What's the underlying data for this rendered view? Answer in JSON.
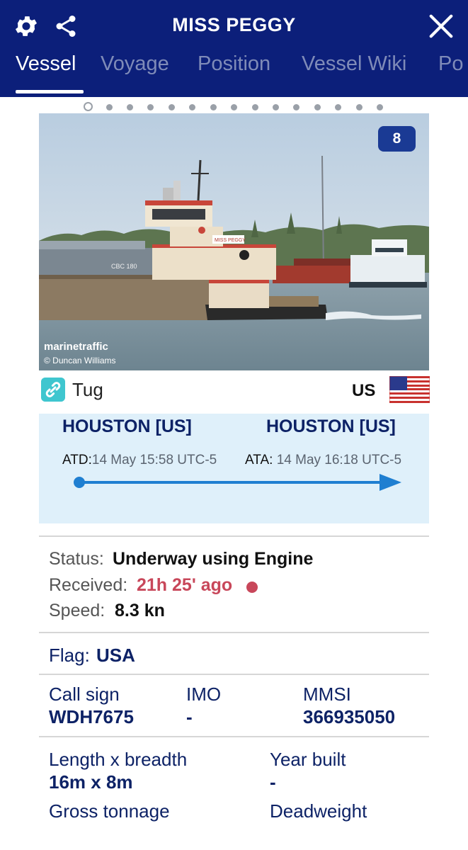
{
  "header": {
    "title": "MISS PEGGY",
    "tabs": [
      {
        "label": "Vessel",
        "active": true
      },
      {
        "label": "Voyage",
        "active": false
      },
      {
        "label": "Position",
        "active": false
      },
      {
        "label": "Vessel Wiki",
        "active": false
      },
      {
        "label": "Po",
        "active": false
      }
    ],
    "icons": [
      "gear-icon",
      "share-icon",
      "close-icon"
    ],
    "bg_color": "#0c1f7a"
  },
  "gallery": {
    "photo_count": "8",
    "watermark": "marinetraffic",
    "credit": "© Duncan Williams",
    "page_indicator": {
      "total": 15,
      "current": 1
    }
  },
  "vessel_type": {
    "type": "Tug",
    "country_code": "US",
    "icon": "link-icon",
    "flag_icon": "us-flag-icon"
  },
  "route": {
    "departure_port": "HOUSTON [US]",
    "arrival_port": "HOUSTON [US]",
    "atd_label": "ATD:",
    "atd_value": "14 May 15:58 UTC-5",
    "ata_label": "ATA:",
    "ata_value": "14 May 16:18 UTC-5",
    "progress": 1.0
  },
  "status": {
    "status_label": "Status:",
    "status_value": "Underway using Engine",
    "received_label": "Received:",
    "received_value": "21h 25' ago",
    "speed_label": "Speed:",
    "speed_value": "8.3 kn",
    "received_color": "#c8475a"
  },
  "flag": {
    "label": "Flag:",
    "value": "USA"
  },
  "ids": {
    "call_sign_label": "Call sign",
    "call_sign_value": "WDH7675",
    "imo_label": "IMO",
    "imo_value": "-",
    "mmsi_label": "MMSI",
    "mmsi_value": "366935050"
  },
  "dimensions": {
    "length_breadth_label": "Length x breadth",
    "length_breadth_value": "16m x 8m",
    "year_built_label": "Year built",
    "year_built_value": "-",
    "gross_tonnage_label": "Gross tonnage",
    "deadweight_label": "Deadweight"
  },
  "colors": {
    "navy": "#0d2266",
    "route_bg": "#dff0fa",
    "arrow": "#1f7fd1"
  }
}
